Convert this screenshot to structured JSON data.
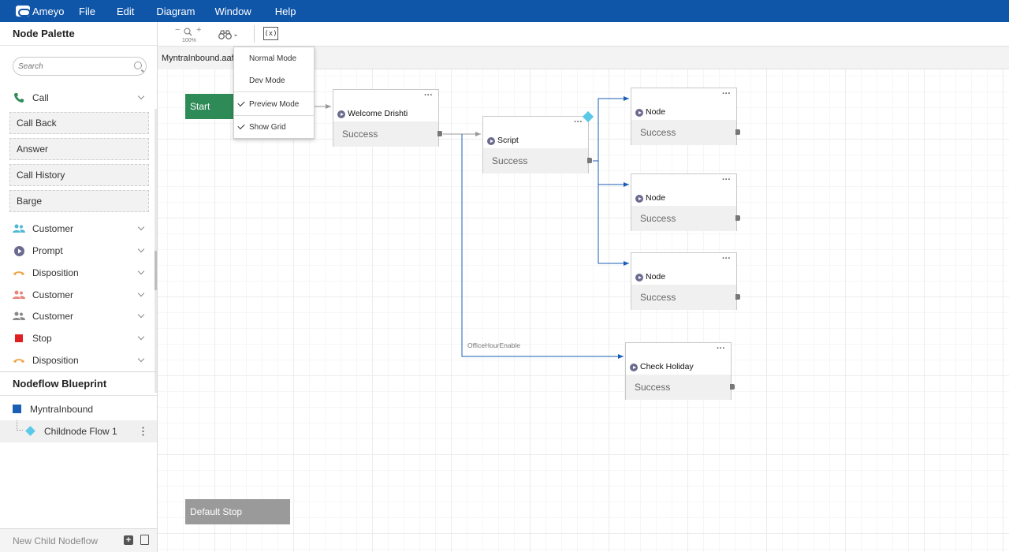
{
  "app": {
    "name": "Ameyo"
  },
  "menubar": {
    "items": [
      "File",
      "Edit",
      "Diagram",
      "Window",
      "Help"
    ]
  },
  "left_panel": {
    "palette_title": "Node Palette",
    "search_placeholder": "Search",
    "palette": [
      {
        "label": "Call",
        "icon": "phone-icon",
        "color": "#2e8b57",
        "expanded": true,
        "children": [
          "Call Back",
          "Answer",
          "Call History",
          "Barge"
        ]
      },
      {
        "label": "Customer",
        "icon": "users-icon",
        "color": "#4db8d4"
      },
      {
        "label": "Prompt",
        "icon": "play-circle-icon",
        "color": "#6b6b8f"
      },
      {
        "label": "Disposition",
        "icon": "hangup-icon",
        "color": "#f0a040"
      },
      {
        "label": "Customer",
        "icon": "users-icon",
        "color": "#e8857a"
      },
      {
        "label": "Customer",
        "icon": "users-icon",
        "color": "#888888"
      },
      {
        "label": "Stop",
        "icon": "stop-icon",
        "color": "#e02020"
      },
      {
        "label": "Disposition",
        "icon": "hangup-icon",
        "color": "#f0a040"
      }
    ],
    "blueprint_title": "Nodeflow Blueprint",
    "blueprint": [
      {
        "label": "MyntraInbound",
        "icon": "square-icon",
        "color": "#1a5fb4"
      },
      {
        "label": "Childnode Flow 1",
        "icon": "diamond-icon",
        "color": "#5bc8e8"
      }
    ],
    "new_child_label": "New Child Nodeflow"
  },
  "toolbar": {
    "zoom_label": "100%",
    "zoom_minus": "−",
    "zoom_plus": "+",
    "variables_label": "(x)"
  },
  "tab": {
    "label": "MyntraInbound.aaf"
  },
  "view_menu": {
    "items": [
      {
        "label": "Normal Mode",
        "checked": false
      },
      {
        "label": "Dev Mode",
        "checked": false
      },
      {
        "label": "Preview Mode",
        "checked": true
      },
      {
        "label": "Show Grid",
        "checked": true
      }
    ]
  },
  "canvas": {
    "start_label": "Start",
    "default_stop_label": "Default Stop",
    "edge_label": "OfficeHourEnable",
    "nodes": [
      {
        "title": "Welcome Drishti",
        "output": "Success"
      },
      {
        "title": "Script",
        "output": "Success"
      },
      {
        "title": "Node",
        "output": "Success"
      },
      {
        "title": "Node",
        "output": "Success"
      },
      {
        "title": "Node",
        "output": "Success"
      },
      {
        "title": "Check Holiday",
        "output": "Success"
      }
    ],
    "colors": {
      "start": "#2e8b57",
      "stop": "#9a9a9a",
      "link": "#1a5fb4",
      "link_default": "#999999",
      "accent": "#5bc8e8"
    }
  }
}
